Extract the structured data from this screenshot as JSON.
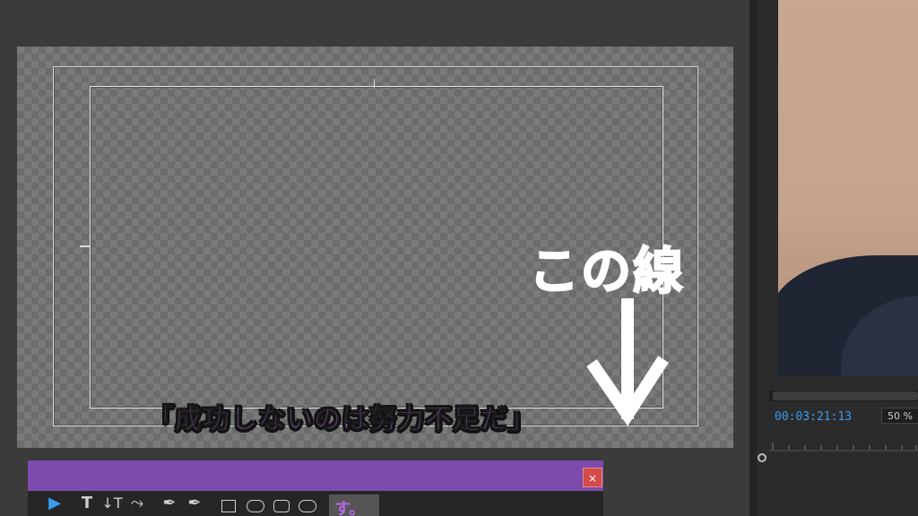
{
  "annotation": {
    "text": "この線"
  },
  "subtitle": {
    "text": "「成功しないのは努力不足だ」"
  },
  "monitor": {
    "timecode": "00:03:21:13",
    "zoom": "50 %"
  },
  "dialog": {
    "close_label": "×",
    "tools": [
      {
        "name": "selection-tool",
        "glyph": "▶"
      },
      {
        "name": "text-tool",
        "glyph": "T"
      },
      {
        "name": "vertical-text-tool",
        "glyph": "↓T"
      },
      {
        "name": "path-text-tool",
        "glyph": "⤳"
      },
      {
        "name": "pen-tool",
        "glyph": "✒"
      },
      {
        "name": "add-anchor-tool",
        "glyph": "✒"
      }
    ],
    "thumbnail_text": "す。"
  },
  "colors": {
    "accent": "#3a9cf0",
    "dialog_title": "#7c4bad",
    "subtitle": "#b469e8",
    "close": "#d24c4c"
  }
}
